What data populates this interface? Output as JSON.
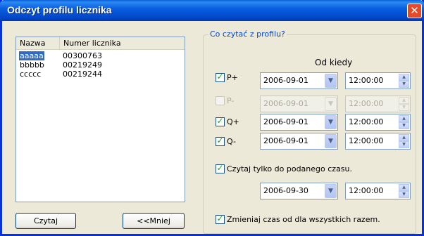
{
  "window": {
    "title": "Odczyt profilu licznika",
    "close_glyph": "✕",
    "close_icon": "close-icon"
  },
  "list": {
    "columns": [
      "Nazwa",
      "Numer licznika"
    ],
    "rows": [
      {
        "name": "aaaaa",
        "number": "00300763",
        "selected": true
      },
      {
        "name": "bbbbb",
        "number": "00219249",
        "selected": false
      },
      {
        "name": "ccccc",
        "number": "00219244",
        "selected": false
      }
    ]
  },
  "buttons": {
    "read": "Czytaj",
    "less": "<<Mniej"
  },
  "group": {
    "title": "Co czytać z profilu?",
    "from_header": "Od kiedy",
    "rows": [
      {
        "label": "P+",
        "checked": true,
        "enabled": true,
        "date": "2006-09-01",
        "time": "12:00:00"
      },
      {
        "label": "P-",
        "checked": false,
        "enabled": false,
        "date": "2006-09-01",
        "time": "12:00:00"
      },
      {
        "label": "Q+",
        "checked": true,
        "enabled": true,
        "date": "2006-09-01",
        "time": "12:00:00"
      },
      {
        "label": "Q-",
        "checked": true,
        "enabled": true,
        "date": "2006-09-01",
        "time": "12:00:00"
      }
    ],
    "until": {
      "label": "Czytaj tylko do podanego czasu.",
      "checked": true,
      "date": "2006-09-30",
      "time": "12:00:00"
    },
    "change_all": {
      "label": "Zmieniaj czas od dla wszystkich razem.",
      "checked": true
    }
  },
  "glyphs": {
    "check": "✓",
    "dropdown": "▼",
    "spin_up": "▲",
    "spin_down": "▼"
  },
  "colors": {
    "title_bar": "#0a5fd8",
    "close": "#e24a2a",
    "selection": "#316ac5",
    "group_title": "#0046d5",
    "check": "#21a121"
  }
}
